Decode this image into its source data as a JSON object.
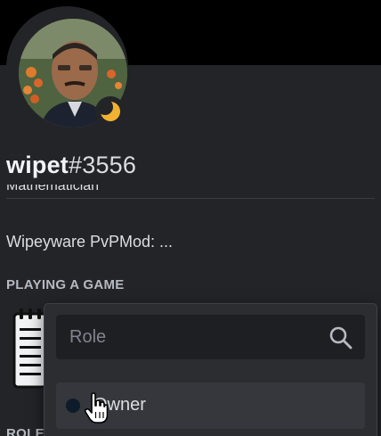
{
  "profile": {
    "username": "wipet",
    "discriminator": "#3556",
    "status": "idle",
    "cut_text": "Mathematician",
    "bio": "Wipeyware PvPMod: ..."
  },
  "sections": {
    "activity_heading": "PLAYING A GAME",
    "roles_heading": "ROLES"
  },
  "role_picker": {
    "search_placeholder": "Role",
    "roles": [
      {
        "name": "Owner",
        "color": "#0d1b2a"
      }
    ]
  },
  "colors": {
    "panel_bg": "#232428",
    "popout_bg": "#2b2d31",
    "input_bg": "#1e1f22",
    "idle_yellow": "#f0b232"
  }
}
